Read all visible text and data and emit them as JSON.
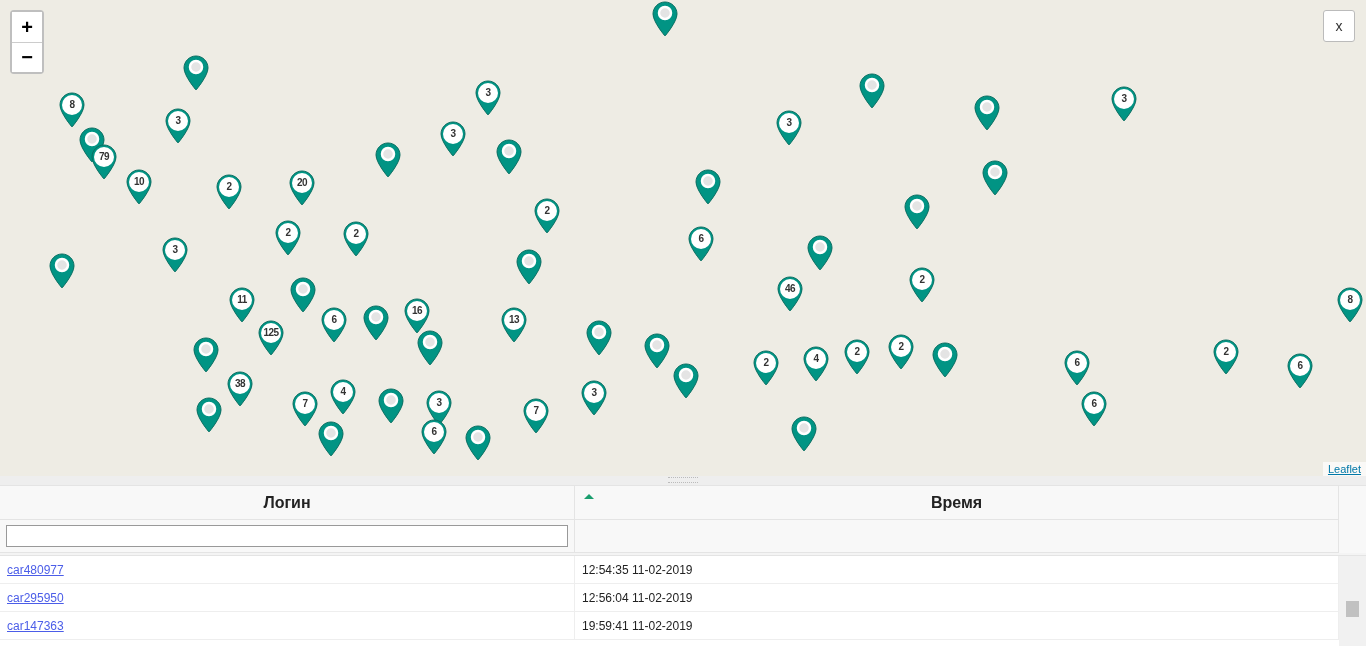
{
  "map": {
    "zoom_in": "+",
    "zoom_out": "−",
    "close": "x",
    "attribution": "Leaflet",
    "markers": [
      {
        "kind": "single"
      },
      {
        "kind": "cluster",
        "label": "8"
      },
      {
        "kind": "single"
      },
      {
        "kind": "cluster",
        "label": "79"
      },
      {
        "kind": "cluster",
        "label": "10"
      },
      {
        "kind": "cluster",
        "label": "3"
      },
      {
        "kind": "cluster",
        "label": "2"
      },
      {
        "kind": "cluster",
        "label": "20"
      },
      {
        "kind": "single"
      },
      {
        "kind": "cluster",
        "label": "3"
      },
      {
        "kind": "cluster",
        "label": "3"
      },
      {
        "kind": "single"
      },
      {
        "kind": "cluster",
        "label": "2"
      },
      {
        "kind": "cluster",
        "label": "2"
      },
      {
        "kind": "cluster",
        "label": "2"
      },
      {
        "kind": "single"
      },
      {
        "kind": "single"
      },
      {
        "kind": "cluster",
        "label": "3"
      },
      {
        "kind": "cluster",
        "label": "11"
      },
      {
        "kind": "single"
      },
      {
        "kind": "cluster",
        "label": "6"
      },
      {
        "kind": "single"
      },
      {
        "kind": "cluster",
        "label": "16"
      },
      {
        "kind": "single"
      },
      {
        "kind": "cluster",
        "label": "13"
      },
      {
        "kind": "cluster",
        "label": "125"
      },
      {
        "kind": "single"
      },
      {
        "kind": "cluster",
        "label": "38"
      },
      {
        "kind": "single"
      },
      {
        "kind": "cluster",
        "label": "7"
      },
      {
        "kind": "single"
      },
      {
        "kind": "cluster",
        "label": "4"
      },
      {
        "kind": "single"
      },
      {
        "kind": "cluster",
        "label": "3"
      },
      {
        "kind": "cluster",
        "label": "6"
      },
      {
        "kind": "single"
      },
      {
        "kind": "cluster",
        "label": "7"
      },
      {
        "kind": "single"
      },
      {
        "kind": "cluster",
        "label": "3"
      },
      {
        "kind": "single"
      },
      {
        "kind": "single"
      },
      {
        "kind": "single"
      },
      {
        "kind": "single"
      },
      {
        "kind": "cluster",
        "label": "6"
      },
      {
        "kind": "cluster",
        "label": "3"
      },
      {
        "kind": "single"
      },
      {
        "kind": "single"
      },
      {
        "kind": "single"
      },
      {
        "kind": "single"
      },
      {
        "kind": "single"
      },
      {
        "kind": "cluster",
        "label": "46"
      },
      {
        "kind": "cluster",
        "label": "2"
      },
      {
        "kind": "cluster",
        "label": "2"
      },
      {
        "kind": "cluster",
        "label": "4"
      },
      {
        "kind": "cluster",
        "label": "2"
      },
      {
        "kind": "cluster",
        "label": "2"
      },
      {
        "kind": "single"
      },
      {
        "kind": "single"
      },
      {
        "kind": "cluster",
        "label": "3"
      },
      {
        "kind": "cluster",
        "label": "6"
      },
      {
        "kind": "cluster",
        "label": "6"
      },
      {
        "kind": "cluster",
        "label": "2"
      },
      {
        "kind": "cluster",
        "label": "6"
      },
      {
        "kind": "cluster",
        "label": "8"
      }
    ]
  },
  "table": {
    "columns": [
      {
        "label": "Логин",
        "sorted": false
      },
      {
        "label": "Время",
        "sorted": true
      }
    ],
    "rows": [
      {
        "login": "car480977",
        "time": "12:54:35 11-02-2019"
      },
      {
        "login": "car295950",
        "time": "12:56:04 11-02-2019"
      },
      {
        "login": "car147363",
        "time": "19:59:41 11-02-2019"
      }
    ]
  }
}
